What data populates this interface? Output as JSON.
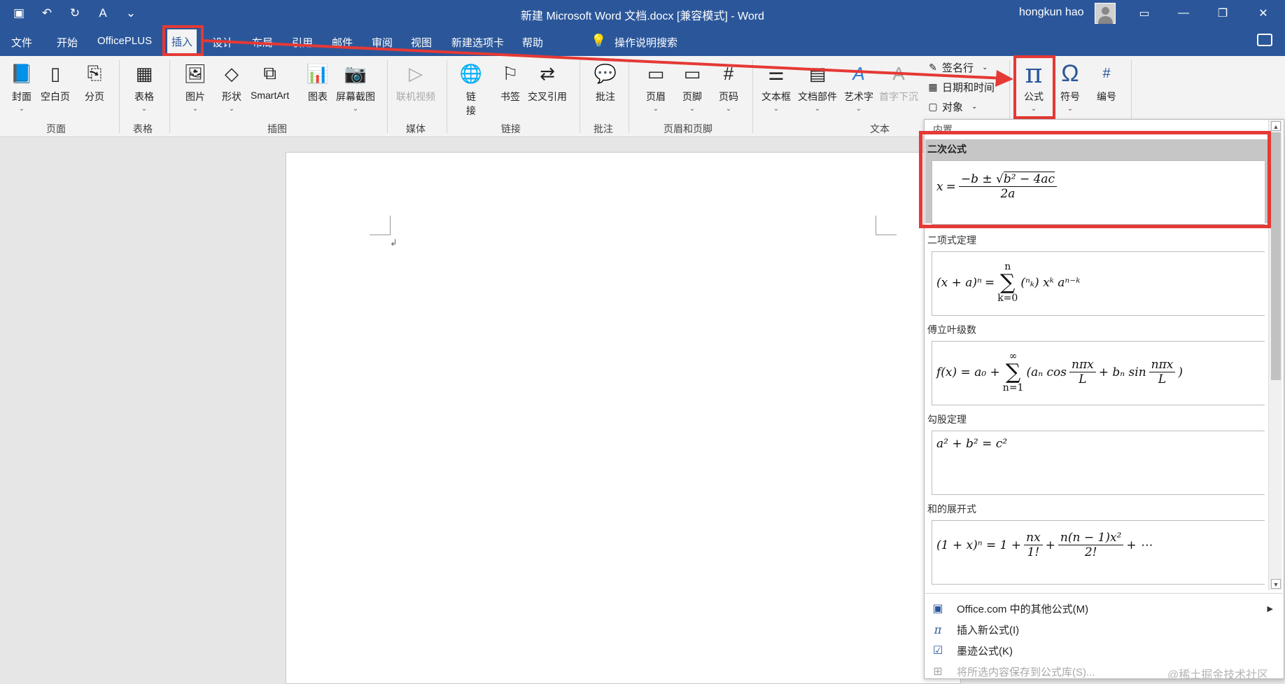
{
  "titlebar": {
    "title": "新建 Microsoft Word 文档.docx [兼容模式]  -  Word",
    "user": "hongkun hao",
    "qat": [
      "save-icon",
      "undo-icon",
      "redo-icon",
      "format-icon",
      "customize-icon"
    ],
    "window_controls": [
      "ribbon-display-icon",
      "minimize-icon",
      "restore-icon",
      "close-icon"
    ]
  },
  "menu": {
    "tabs": [
      "文件",
      "开始",
      "OfficePLUS",
      "插入",
      "设计",
      "布局",
      "引用",
      "邮件",
      "审阅",
      "视图",
      "新建选项卡",
      "帮助"
    ],
    "active_tab": "插入",
    "search": "操作说明搜索"
  },
  "ribbon": {
    "groups": {
      "pages": "页面",
      "tables": "表格",
      "illustrations": "插图",
      "media": "媒体",
      "links": "链接",
      "comments": "批注",
      "header_footer": "页眉和页脚",
      "text": "文本"
    },
    "buttons": {
      "cover": "封面",
      "blank_page": "空白页",
      "page_break": "分页",
      "table": "表格",
      "picture": "图片",
      "shapes": "形状",
      "smartart": "SmartArt",
      "chart": "图表",
      "screenshot": "屏幕截图",
      "online_video": "联机视频",
      "link_1": "链",
      "link_2": "接",
      "bookmark": "书签",
      "cross_ref": "交叉引用",
      "comment": "批注",
      "header": "页眉",
      "footer": "页脚",
      "page_number": "页码",
      "textbox": "文本框",
      "quick_parts": "文档部件",
      "wordart": "艺术字",
      "drop_cap": "首字下沉",
      "signature": "签名行",
      "datetime": "日期和时间",
      "object": "对象",
      "equation": "公式",
      "symbol": "符号",
      "number": "编号"
    }
  },
  "dropdown": {
    "header": "内置",
    "equations": [
      {
        "title": "二次公式"
      },
      {
        "title": "二项式定理"
      },
      {
        "title": "傅立叶级数"
      },
      {
        "title": "勾股定理"
      },
      {
        "title": "和的展开式"
      }
    ],
    "menu": [
      {
        "label": "Office.com 中的其他公式(M)",
        "icon": "office-equation-icon",
        "enabled": true
      },
      {
        "label": "插入新公式(I)",
        "icon": "pi-icon",
        "enabled": true
      },
      {
        "label": "墨迹公式(K)",
        "icon": "ink-equation-icon",
        "enabled": true
      },
      {
        "label": "将所选内容保存到公式库(S)...",
        "icon": "save-to-gallery-icon",
        "enabled": false
      }
    ]
  },
  "watermark": "@稀土掘金技术社区",
  "colors": {
    "titlebar": "#2b579a",
    "highlight": "#e53935",
    "ribbon_bg": "#f3f3f3"
  }
}
